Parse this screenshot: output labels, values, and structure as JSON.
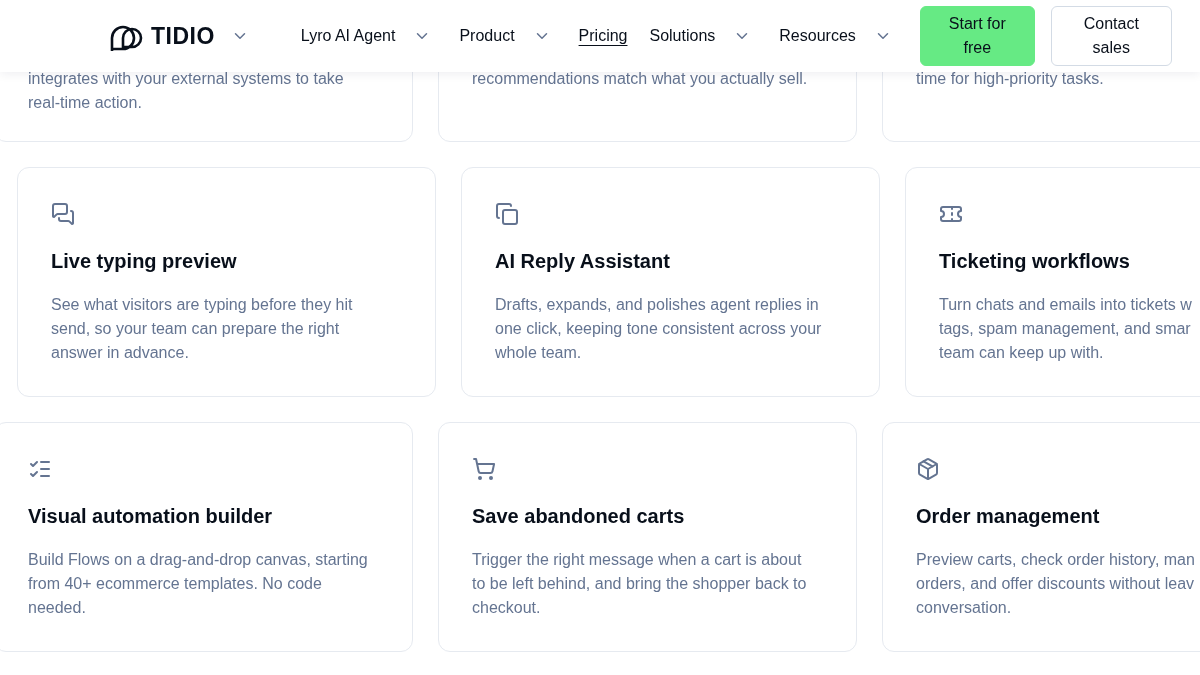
{
  "header": {
    "logo": "TIDIO",
    "logo_dropdown": true,
    "nav": [
      {
        "label": "Lyro AI Agent",
        "kind": "dropdown"
      },
      {
        "label": "Product",
        "kind": "dropdown"
      },
      {
        "label": "Pricing",
        "kind": "link"
      },
      {
        "label": "Solutions",
        "kind": "dropdown"
      },
      {
        "label": "Resources",
        "kind": "dropdown"
      }
    ],
    "buttons": [
      {
        "label": "Start for free",
        "kind": "primary"
      },
      {
        "label": "Contact sales",
        "kind": "secondary"
      }
    ]
  },
  "rows": [
    {
      "kind": "clipped",
      "cards": [
        {
          "description_lines": [
            "integrates with your external systems to take",
            "real-time action."
          ]
        },
        {
          "description_lines": [
            "recommendations match what you actually sell."
          ]
        },
        {
          "description_lines": [
            "time for high-priority tasks."
          ]
        }
      ]
    },
    {
      "kind": "full",
      "cards": [
        {
          "title": "Live typing preview",
          "description_lines": [
            "See what visitors are typing before they hit",
            "send, so your team can prepare the right",
            "answer in advance."
          ]
        },
        {
          "title": "AI Reply Assistant",
          "description_lines": [
            "Drafts, expands, and polishes agent replies in",
            "one click, keeping tone consistent across your",
            "whole team."
          ]
        },
        {
          "title": "Ticketing workflows",
          "description_lines": [
            "Turn chats and emails into tickets w",
            "tags, spam management, and smar",
            "team can keep up with."
          ]
        }
      ]
    },
    {
      "kind": "full",
      "cards": [
        {
          "title": "Visual automation builder",
          "description_lines": [
            "Build Flows on a drag-and-drop canvas, starting",
            "from 40+ ecommerce templates. No code",
            "needed."
          ]
        },
        {
          "title": "Save abandoned carts",
          "description_lines": [
            "Trigger the right message when a cart is about",
            "to be left behind, and bring the shopper back to",
            "checkout."
          ]
        },
        {
          "title": "Order management",
          "description_lines": [
            "Preview carts, check order history, man",
            "orders, and offer discounts without leav",
            "conversation."
          ]
        }
      ]
    }
  ]
}
